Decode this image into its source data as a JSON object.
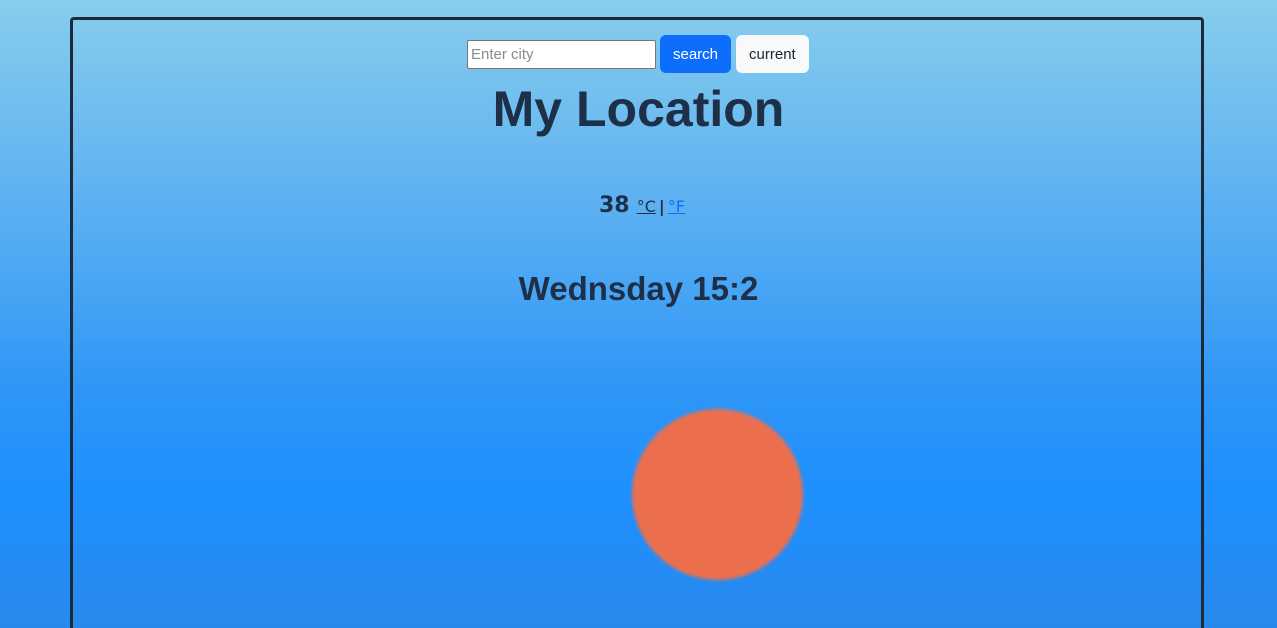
{
  "search": {
    "placeholder": "Enter city",
    "value": "",
    "search_label": "search",
    "current_label": "current"
  },
  "location": {
    "title": "My Location"
  },
  "weather": {
    "temperature": "38",
    "unit_celsius": "°C",
    "separator": "|",
    "unit_fahrenheit": "°F",
    "day_time": "Wednsday 15:2"
  },
  "colors": {
    "accent": "#0d6efd",
    "text": "#1e3048",
    "sun": "#eb6f4d",
    "sky": "#1e90ff"
  },
  "icons": {
    "weather_icon": "sun-icon"
  }
}
